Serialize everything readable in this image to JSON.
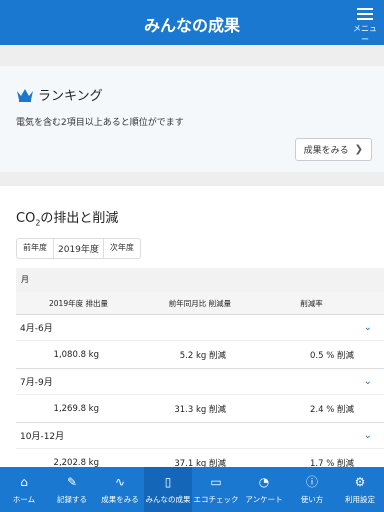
{
  "header": {
    "title": "みんなの成果",
    "menu_label": "メニュー"
  },
  "ranking": {
    "title": "ランキング",
    "description": "電気を含む2項目以上あると順位がでます",
    "button": "成果をみる"
  },
  "co2": {
    "title_prefix": "CO",
    "title_sub": "2",
    "title_suffix": "の排出と削減",
    "years": {
      "prev": "前年度",
      "current": "2019年度",
      "next": "次年度"
    },
    "table": {
      "row_label": "月",
      "columns": [
        "2019年度 排出量",
        "前年同月比 削減量",
        "削減率"
      ],
      "groups": [
        {
          "label": "4月-6月",
          "emission": "1,080.8 kg",
          "reduction": "5.2 kg 削減",
          "rate": "0.5 % 削減"
        },
        {
          "label": "7月-9月",
          "emission": "1,269.8 kg",
          "reduction": "31.3 kg 削減",
          "rate": "2.4 % 削減"
        },
        {
          "label": "10月-12月",
          "emission": "2,202.8 kg",
          "reduction": "37.1 kg 削減",
          "rate": "1.7 % 削減"
        }
      ]
    }
  },
  "tabs": [
    {
      "label": "ホーム",
      "icon": "home-icon"
    },
    {
      "label": "記録する",
      "icon": "pencil-icon"
    },
    {
      "label": "成果をみる",
      "icon": "pulse-icon"
    },
    {
      "label": "みんなの成果",
      "icon": "clipboard-icon"
    },
    {
      "label": "エコチェック",
      "icon": "chat-icon"
    },
    {
      "label": "アンケート",
      "icon": "pie-icon"
    },
    {
      "label": "使い方",
      "icon": "info-icon"
    },
    {
      "label": "利用設定",
      "icon": "gear-icon"
    }
  ],
  "colors": {
    "primary": "#1a78d0",
    "crown": "#1a78d0"
  }
}
